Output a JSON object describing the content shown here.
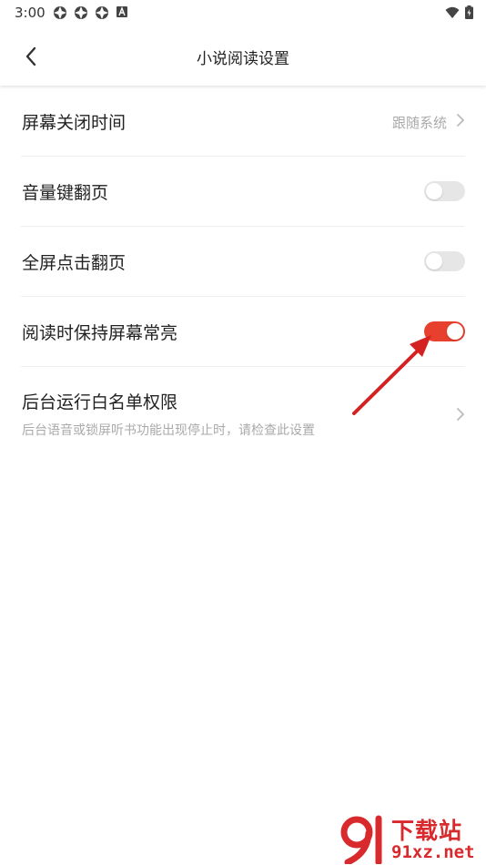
{
  "status_bar": {
    "time": "3:00",
    "notification_icons": [
      "app-icon",
      "app-icon",
      "app-icon",
      "a-icon"
    ],
    "right_icons": [
      "wifi-icon",
      "battery-icon"
    ]
  },
  "header": {
    "title": "小说阅读设置",
    "back_icon": "chevron-left-icon"
  },
  "settings": {
    "screen_off": {
      "label": "屏幕关闭时间",
      "value": "跟随系统"
    },
    "volume_key": {
      "label": "音量键翻页",
      "enabled": false
    },
    "fullscreen_tap": {
      "label": "全屏点击翻页",
      "enabled": false
    },
    "keep_screen_on": {
      "label": "阅读时保持屏幕常亮",
      "enabled": true
    },
    "background_whitelist": {
      "label": "后台运行白名单权限",
      "subtitle": "后台语音或锁屏听书功能出现停止时，请检查此设置"
    }
  },
  "colors": {
    "accent": "#e8402f",
    "toggle_off": "#e6e6e6",
    "annotation_arrow": "#d42222"
  },
  "watermark": {
    "line1": "下载站",
    "line2": "91xz.net"
  }
}
